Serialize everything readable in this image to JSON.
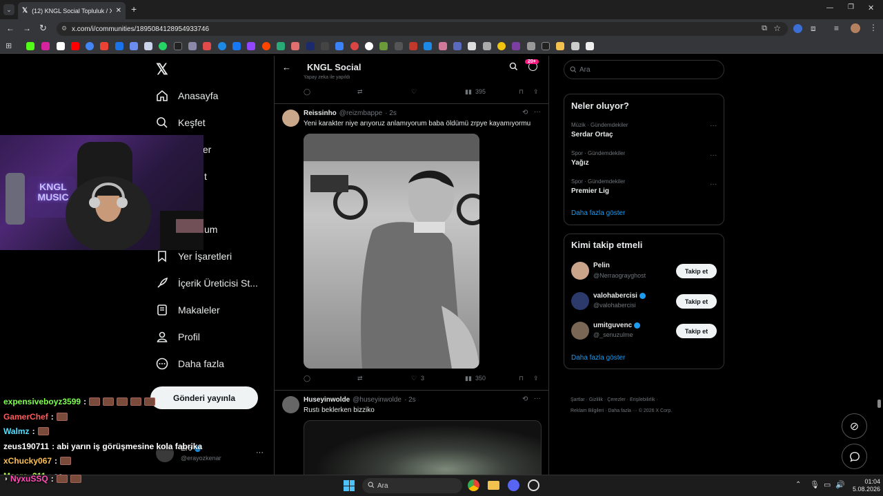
{
  "browser": {
    "tab_title": "(12) KNGL Social Topluluk / X",
    "url": "x.com/i/communities/1895084128954933746"
  },
  "nav": {
    "items": [
      {
        "label": "Anasayfa"
      },
      {
        "label": "Keşfet"
      },
      {
        "label": "nler"
      },
      {
        "label": "t"
      },
      {
        "label": "um"
      },
      {
        "label": "Yer İşaretleri"
      },
      {
        "label": "İçerik Üreticisi St..."
      },
      {
        "label": "Makaleler"
      },
      {
        "label": "Profil"
      },
      {
        "label": "Daha fazla"
      }
    ],
    "post_button": "Gönderi yayınla",
    "account_name": "Ero",
    "account_handle": "@erayozkenar"
  },
  "header": {
    "title": "KNGL Social",
    "badge": "20+"
  },
  "top_post": {
    "partial_text": "Yapay zeka ile yapıldı",
    "views": "395"
  },
  "post1": {
    "name": "Reissinho",
    "handle": "@reizmbappe",
    "time": "· 2s",
    "text": "Yeni karakter niye arıyoruz anlamıyorum baba öldümü zrpye kayamıyormu",
    "likes": "3",
    "views": "350"
  },
  "post2": {
    "name": "Huseyinwolde",
    "handle": "@huseyinwolde",
    "time": "· 2s",
    "text": "Rustı beklerken bizziko"
  },
  "right": {
    "search_placeholder": "Ara",
    "trends_title": "Neler oluyor?",
    "trends": [
      {
        "category": "Müzik · Gündemdekiler",
        "name": "Serdar Ortaç"
      },
      {
        "category": "Spor · Gündemdekiler",
        "name": "Yağız"
      },
      {
        "category": "Spor · Gündemdekiler",
        "name": "Premier Lig"
      }
    ],
    "show_more": "Daha fazla göster",
    "who_title": "Kimi takip etmeli",
    "who": [
      {
        "name": "Pelin",
        "handle": "@Nerraograyghost",
        "button": "Takip et"
      },
      {
        "name": "valohabercisi",
        "handle": "@valohabercisi",
        "button": "Takip et"
      },
      {
        "name": "umitguvenc",
        "handle": "@_senuzulme",
        "button": "Takip et"
      }
    ],
    "who_more": "Daha fazla göster",
    "footer1": "Şartlar  ·  Gizlilik  ·  Çerezler  ·  Erişilebilirlik  ·",
    "footer2": "Reklam Bilgileri  ·  Daha fazla ···  © 2026 X Corp."
  },
  "webcam": {
    "sign_text": "KNGL MUSIC"
  },
  "chat": [
    {
      "user": "expensiveboyz3599",
      "color": "#7fff4f",
      "msg": ":",
      "emotes": 5
    },
    {
      "user": "GamerChef",
      "color": "#ff5c5c",
      "msg": ":",
      "emotes": 1
    },
    {
      "user": "Walmz",
      "color": "#4fe0ff",
      "msg": ":",
      "emotes": 1
    },
    {
      "user": "zeus190711",
      "color": "#ffffff",
      "msg": ": abi yarın iş görüşmesine kola fabrika",
      "emotes": 0
    },
    {
      "user": "xChucky067",
      "color": "#ffc04f",
      "msg": ":",
      "emotes": 1
    },
    {
      "user": "Macro_311",
      "color": "#b4ff4f",
      "msg": ": sa",
      "emotes": 0
    },
    {
      "user": "NyxuSSQ",
      "color": "#ff4fb4",
      "msg": ":",
      "emotes": 2
    }
  ],
  "taskbar": {
    "search": "Ara",
    "time": "01:04",
    "date": "5.08.2026"
  },
  "colors": {
    "accent": "#1d9bf0",
    "badge": "#f91880"
  }
}
